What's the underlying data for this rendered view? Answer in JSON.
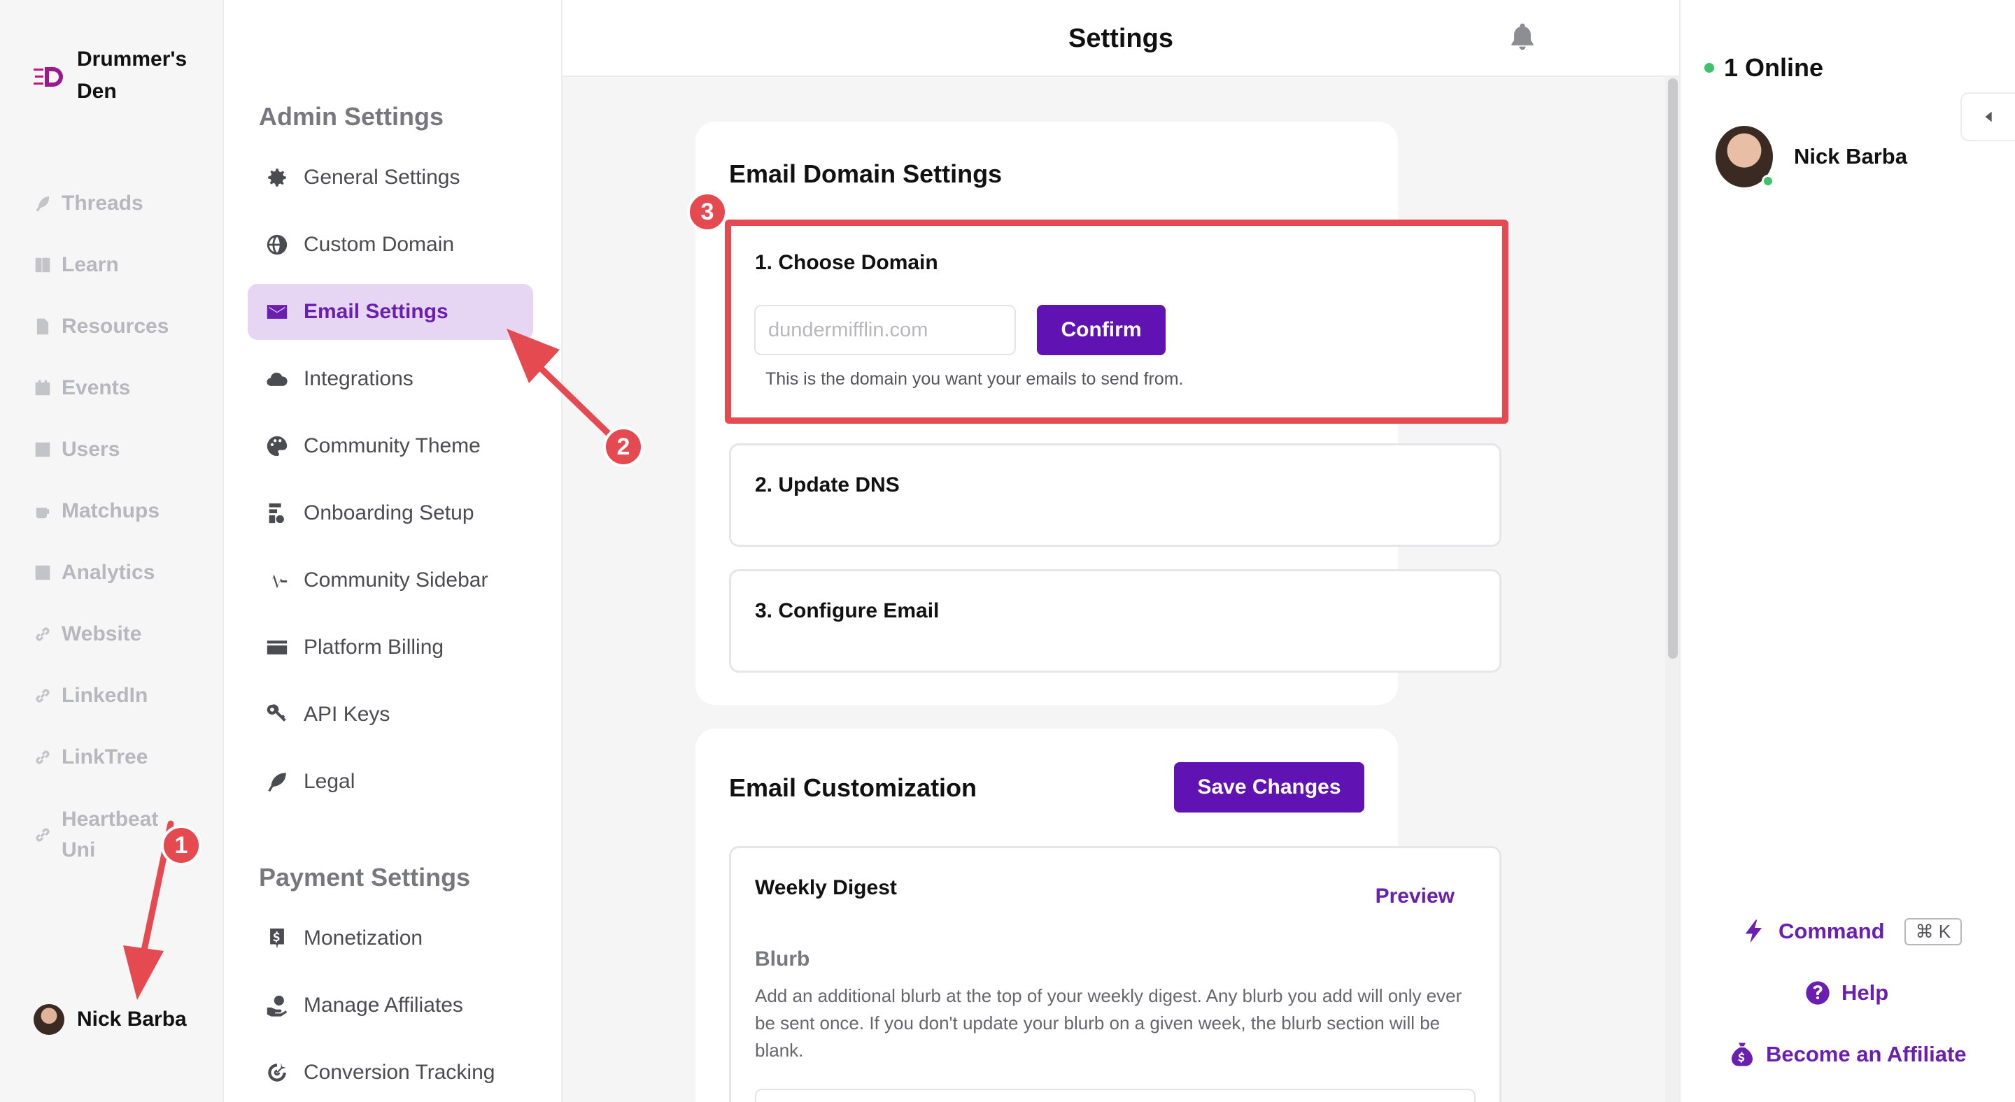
{
  "brand": {
    "name": "Drummer's Den"
  },
  "left_nav": {
    "items": [
      {
        "label": "Threads",
        "icon": "feather-icon"
      },
      {
        "label": "Learn",
        "icon": "book-icon"
      },
      {
        "label": "Resources",
        "icon": "file-icon"
      },
      {
        "label": "Events",
        "icon": "calendar-icon"
      },
      {
        "label": "Users",
        "icon": "user-card-icon"
      },
      {
        "label": "Matchups",
        "icon": "mug-icon"
      },
      {
        "label": "Analytics",
        "icon": "chart-icon"
      },
      {
        "label": "Website",
        "icon": "link-icon"
      },
      {
        "label": "LinkedIn",
        "icon": "link-icon"
      },
      {
        "label": "LinkTree",
        "icon": "link-icon"
      },
      {
        "label": "Heartbeat Uni",
        "icon": "link-icon"
      }
    ],
    "user": {
      "name": "Nick Barba"
    }
  },
  "settings_nav": {
    "admin_title": "Admin Settings",
    "admin_items": [
      {
        "label": "General Settings",
        "icon": "gear-icon"
      },
      {
        "label": "Custom Domain",
        "icon": "globe-icon"
      },
      {
        "label": "Email Settings",
        "icon": "envelope-icon"
      },
      {
        "label": "Integrations",
        "icon": "cloud-icon"
      },
      {
        "label": "Community Theme",
        "icon": "palette-icon"
      },
      {
        "label": "Onboarding Setup",
        "icon": "onboarding-icon"
      },
      {
        "label": "Community Sidebar",
        "icon": "pulse-icon"
      },
      {
        "label": "Platform Billing",
        "icon": "wallet-icon"
      },
      {
        "label": "API Keys",
        "icon": "key-icon"
      },
      {
        "label": "Legal",
        "icon": "feather-icon"
      }
    ],
    "payment_title": "Payment Settings",
    "payment_items": [
      {
        "label": "Monetization",
        "icon": "dollar-icon"
      },
      {
        "label": "Manage Affiliates",
        "icon": "hand-coin-icon"
      },
      {
        "label": "Conversion Tracking",
        "icon": "target-icon"
      }
    ]
  },
  "header": {
    "title": "Settings"
  },
  "email_domain": {
    "title": "Email Domain Settings",
    "step1_title": "1. Choose Domain",
    "domain_placeholder": "dundermifflin.com",
    "confirm_label": "Confirm",
    "hint": "This is the domain you want your emails to send from.",
    "step2_title": "2. Update DNS",
    "step3_title": "3. Configure Email"
  },
  "email_custom": {
    "title": "Email Customization",
    "save_label": "Save Changes",
    "digest_title": "Weekly Digest",
    "preview_label": "Preview",
    "blurb_title": "Blurb",
    "blurb_desc": "Add an additional blurb at the top of your weekly digest. Any blurb you add will only ever be sent once. If you don't update your blurb on a given week, the blurb section will be blank."
  },
  "right_panel": {
    "online_label": "1 Online",
    "member_name": "Nick Barba",
    "command_label": "Command",
    "command_shortcut": "⌘ K",
    "help_label": "Help",
    "affiliate_label": "Become an Affiliate"
  },
  "annotations": [
    "1",
    "2",
    "3"
  ],
  "colors": {
    "accent": "#6012b3",
    "annotation": "#e44a50",
    "online": "#3ec26a"
  }
}
